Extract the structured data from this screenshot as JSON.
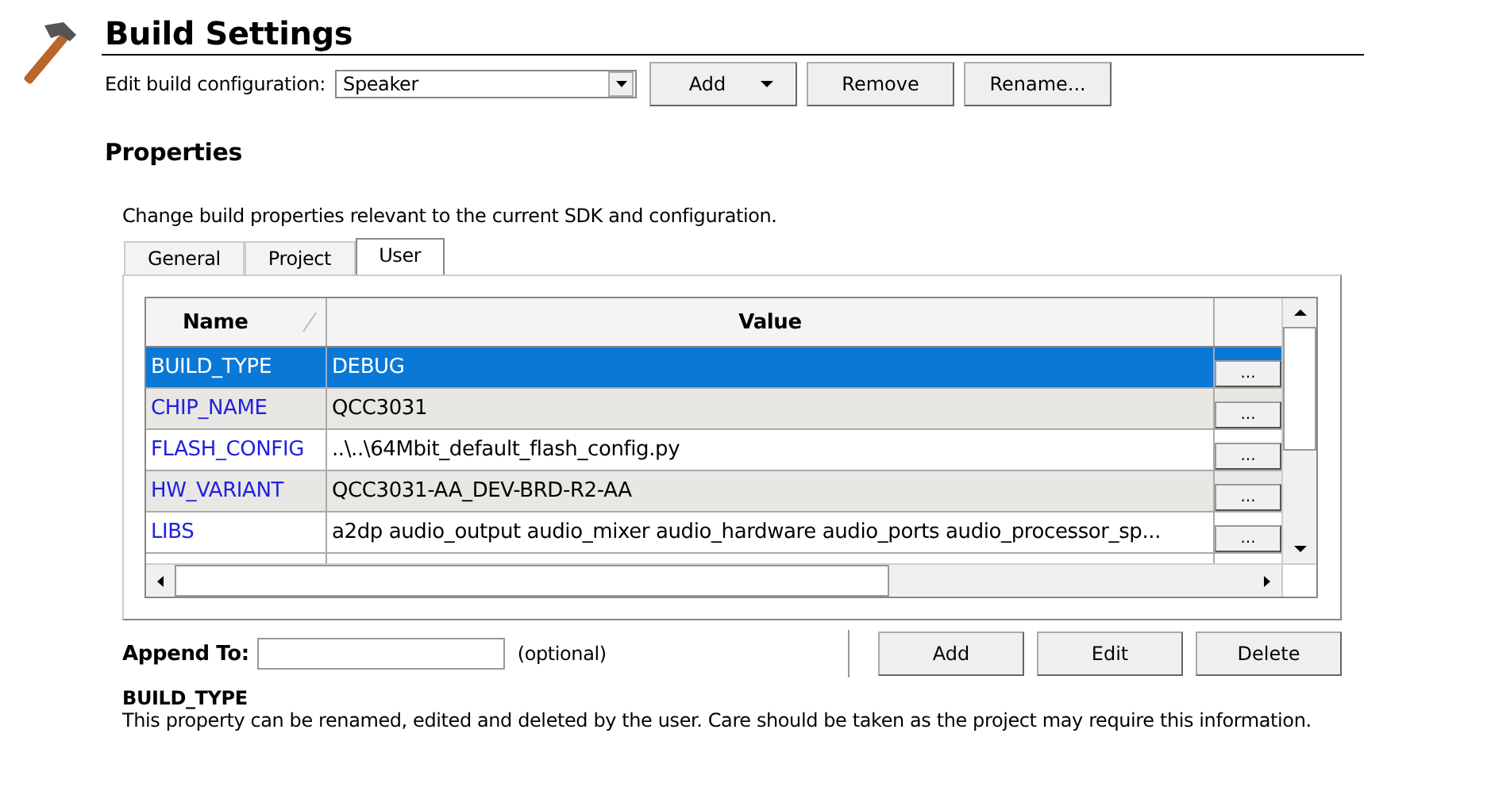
{
  "title": "Build Settings",
  "config": {
    "label": "Edit build configuration:",
    "value": "Speaker"
  },
  "config_buttons": [
    {
      "label": "Add",
      "kind": "dropdown"
    },
    {
      "label": "Remove",
      "kind": "plain"
    },
    {
      "label": "Rename...",
      "kind": "plain"
    }
  ],
  "section_title": "Properties",
  "description": "Change build properties relevant to the current SDK and configuration.",
  "tabs": [
    {
      "label": "General",
      "selected": false
    },
    {
      "label": "Project",
      "selected": false
    },
    {
      "label": "User",
      "selected": true
    }
  ],
  "table": {
    "columns": [
      "Name",
      "Value"
    ],
    "rows": [
      {
        "name": "BUILD_TYPE",
        "value": "DEBUG",
        "button": "...",
        "selected": true
      },
      {
        "name": "CHIP_NAME",
        "value": "QCC3031",
        "button": "...",
        "selected": false
      },
      {
        "name": "FLASH_CONFIG",
        "value": "..\\..\\64Mbit_default_flash_config.py",
        "button": "...",
        "selected": false
      },
      {
        "name": "HW_VARIANT",
        "value": "QCC3031-AA_DEV-BRD-R2-AA",
        "button": "...",
        "selected": false
      },
      {
        "name": "LIBS",
        "value": "a2dp audio_output audio_mixer audio_hardware audio_ports audio_processor_sp...",
        "button": "...",
        "selected": false
      }
    ]
  },
  "append": {
    "label": "Append To",
    "colon": ":",
    "hint": "(optional)"
  },
  "actions": [
    "Add",
    "Edit",
    "Delete"
  ],
  "info": {
    "title": "BUILD_TYPE",
    "text": "This property can be renamed, edited and deleted by the user. Care should be taken as the project may require this information."
  }
}
